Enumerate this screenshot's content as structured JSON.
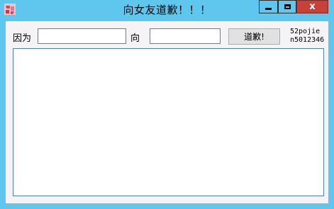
{
  "window": {
    "title": "向女友道歉！！！",
    "icon": "app-icon",
    "controls": {
      "minimize_icon": "minimize-icon",
      "maximize_icon": "maximize-icon",
      "close_label": "x"
    },
    "accent": "#5fc6ee",
    "close_color": "#c7403a"
  },
  "form": {
    "because_label": "因为",
    "because_value": "",
    "to_label": "向",
    "to_value": "",
    "apologize_label": "道歉!",
    "credit_line1": "52pojie",
    "credit_line2": "n5012346"
  },
  "output": {
    "value": ""
  }
}
